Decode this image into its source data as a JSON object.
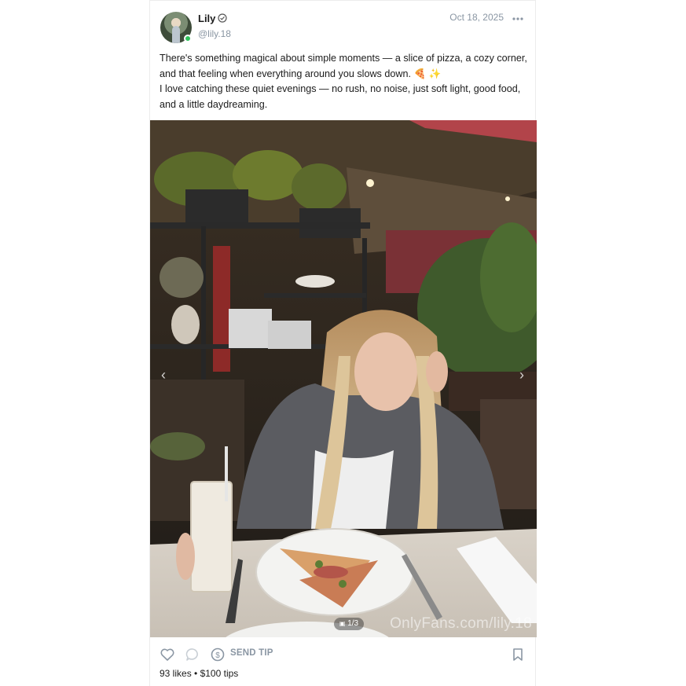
{
  "post": {
    "author": {
      "name": "Lily",
      "handle": "@lily.18",
      "online": true,
      "verified": true
    },
    "date": "Oct 18, 2025",
    "caption": {
      "line1": "There's something magical about simple moments — a slice of pizza, a cozy corner, and that feeling when everything around you slows down. 🍕 ✨",
      "line2": "I love catching these quiet evenings — no rush, no noise, just soft light, good food, and a little daydreaming."
    },
    "media": {
      "counter": "1/3",
      "watermark": "OnlyFans.com/lily.18"
    },
    "actions": {
      "send_tip_label": "SEND TIP"
    },
    "stats": {
      "likes": "93 likes",
      "separator": "•",
      "tips": "$100 tips"
    }
  },
  "icons": [
    "verified-icon",
    "more-options-icon",
    "heart-icon",
    "comment-icon",
    "tip-dollar-icon",
    "bookmark-icon",
    "gallery-icon",
    "chevron-left-icon",
    "chevron-right-icon"
  ],
  "colors": {
    "muted_text": "#8a96a3",
    "online": "#2fc15b"
  }
}
